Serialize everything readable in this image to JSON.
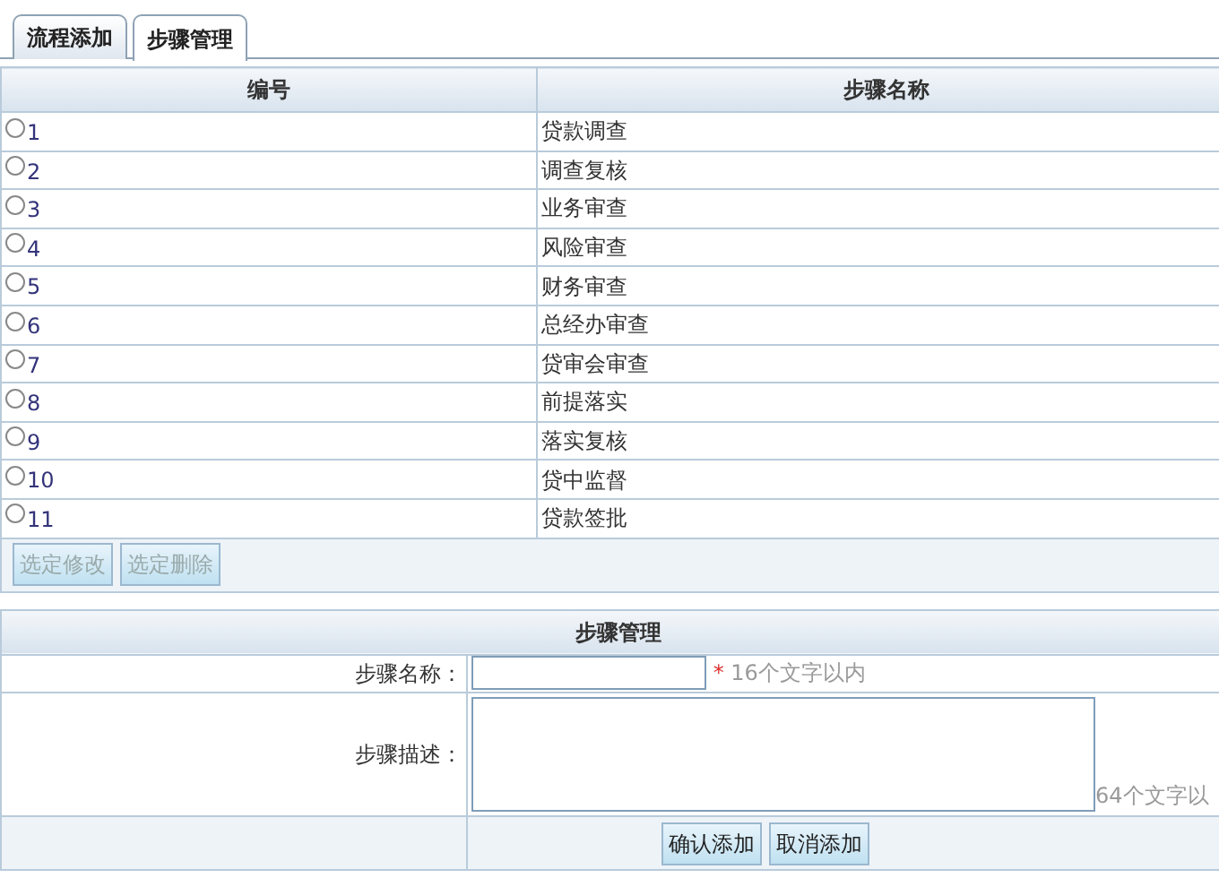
{
  "tabs": [
    {
      "label": "流程添加",
      "selected": false
    },
    {
      "label": "步骤管理",
      "selected": true
    }
  ],
  "steps_table": {
    "columns": [
      "编号",
      "步骤名称"
    ],
    "rows": [
      {
        "number": "1",
        "name": "贷款调查",
        "selected": false
      },
      {
        "number": "2",
        "name": "调查复核",
        "selected": false
      },
      {
        "number": "3",
        "name": "业务审查",
        "selected": false
      },
      {
        "number": "4",
        "name": "风险审查",
        "selected": false
      },
      {
        "number": "5",
        "name": "财务审查",
        "selected": false
      },
      {
        "number": "6",
        "name": "总经办审查",
        "selected": false
      },
      {
        "number": "7",
        "name": "贷审会审查",
        "selected": false
      },
      {
        "number": "8",
        "name": "前提落实",
        "selected": false
      },
      {
        "number": "9",
        "name": "落实复核",
        "selected": false
      },
      {
        "number": "10",
        "name": "贷中监督",
        "selected": false
      },
      {
        "number": "11",
        "name": "贷款签批",
        "selected": false
      }
    ],
    "buttons": [
      "选定修改",
      "选定删除"
    ]
  },
  "form": {
    "title": "步骤管理",
    "fields": [
      {
        "kind": "input",
        "label": "步骤名称：",
        "required_mark": "*",
        "hint": "16个文字以内"
      },
      {
        "kind": "textarea",
        "label": "步骤描述：",
        "hint": "64个文字以"
      }
    ],
    "buttons": [
      "确认添加",
      "取消添加"
    ]
  }
}
